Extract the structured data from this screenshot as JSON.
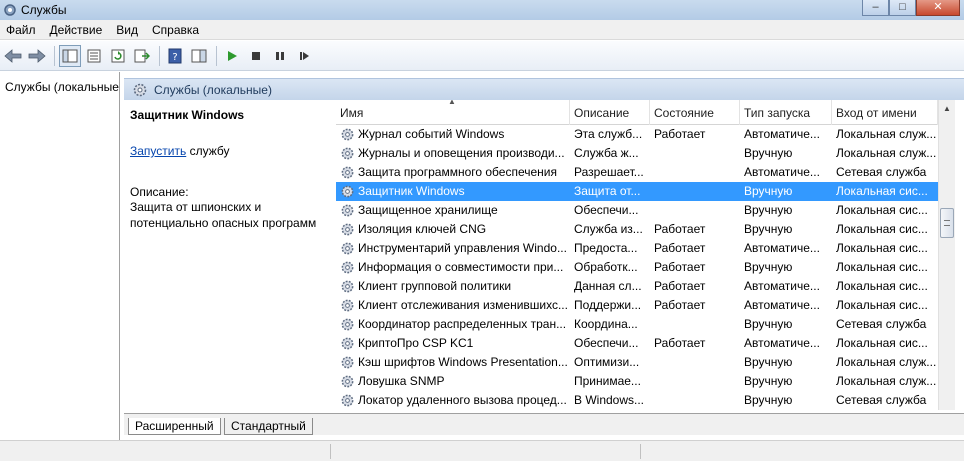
{
  "window": {
    "title": "Службы",
    "controls": {
      "minimize": "–",
      "maximize": "□",
      "close": "✕"
    }
  },
  "menu": {
    "items": [
      "Файл",
      "Действие",
      "Вид",
      "Справка"
    ]
  },
  "toolbar": {
    "icons": [
      "back-arrow-icon",
      "forward-arrow-icon",
      "console-tree-icon",
      "properties-icon",
      "refresh-icon",
      "export-icon",
      "help-icon",
      "action-pane-icon",
      "play-icon",
      "stop-icon",
      "pause-icon",
      "restart-icon"
    ]
  },
  "tree": {
    "root_label": "Службы (локальные)"
  },
  "panel": {
    "header_label": "Службы (локальные)"
  },
  "description": {
    "service_name": "Защитник Windows",
    "start_link": "Запустить",
    "start_suffix": " службу",
    "label": "Описание:",
    "line1": "Защита от шпионских и",
    "line2": "потенциально опасных программ"
  },
  "table": {
    "columns": [
      "Имя",
      "Описание",
      "Состояние",
      "Тип запуска",
      "Вход от имени"
    ],
    "selected_index": 3,
    "rows": [
      [
        "Журнал событий Windows",
        "Эта служб...",
        "Работает",
        "Автоматиче...",
        "Локальная служ..."
      ],
      [
        "Журналы и оповещения производи...",
        "Служба ж...",
        "",
        "Вручную",
        "Локальная служ..."
      ],
      [
        "Защита программного обеспечения",
        "Разрешает...",
        "",
        "Автоматиче...",
        "Сетевая служба"
      ],
      [
        "Защитник Windows",
        "Защита от...",
        "",
        "Вручную",
        "Локальная сис..."
      ],
      [
        "Защищенное хранилище",
        "Обеспечи...",
        "",
        "Вручную",
        "Локальная сис..."
      ],
      [
        "Изоляция ключей CNG",
        "Служба из...",
        "Работает",
        "Вручную",
        "Локальная сис..."
      ],
      [
        "Инструментарий управления Windo...",
        "Предоста...",
        "Работает",
        "Автоматиче...",
        "Локальная сис..."
      ],
      [
        "Информация о совместимости при...",
        "Обработк...",
        "Работает",
        "Вручную",
        "Локальная сис..."
      ],
      [
        "Клиент групповой политики",
        "Данная сл...",
        "Работает",
        "Автоматиче...",
        "Локальная сис..."
      ],
      [
        "Клиент отслеживания изменившихс...",
        "Поддержи...",
        "Работает",
        "Автоматиче...",
        "Локальная сис..."
      ],
      [
        "Координатор распределенных тран...",
        "Координа...",
        "",
        "Вручную",
        "Сетевая служба"
      ],
      [
        "КриптоПро CSP KC1",
        "Обеспечи...",
        "Работает",
        "Автоматиче...",
        "Локальная сис..."
      ],
      [
        "Кэш шрифтов Windows Presentation...",
        "Оптимизи...",
        "",
        "Вручную",
        "Локальная служ..."
      ],
      [
        "Ловушка SNMP",
        "Принимае...",
        "",
        "Вручную",
        "Локальная служ..."
      ],
      [
        "Локатор удаленного вызова процед...",
        "В Windows...",
        "",
        "Вручную",
        "Сетевая служба"
      ]
    ]
  },
  "tabs": {
    "extended": "Расширенный",
    "standard": "Стандартный"
  },
  "colors": {
    "selection": "#3399ff",
    "link": "#0645ad",
    "header_gradient_top": "#dbe6f4"
  }
}
